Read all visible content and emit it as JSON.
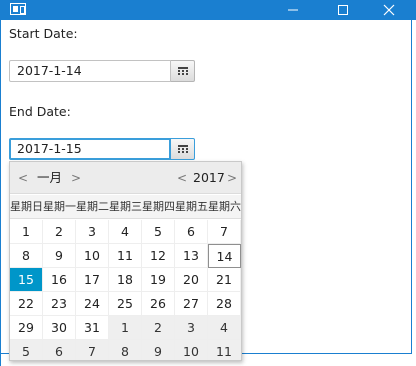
{
  "window": {
    "icons": [
      "app-icon",
      "minimize-icon",
      "maximize-icon",
      "close-icon"
    ],
    "accent_color": "#1a7fd0"
  },
  "form": {
    "start_label": "Start Date:",
    "start_value": "2017-1-14",
    "end_label": "End Date:",
    "end_value": "2017-1-15"
  },
  "calendar": {
    "month": "一月",
    "year": "2017",
    "prev": "<",
    "next": ">",
    "weekdays": [
      "星期日",
      "星期一",
      "星期二",
      "星期三",
      "星期四",
      "星期五",
      "星期六"
    ],
    "weeks": [
      [
        "1",
        "2",
        "3",
        "4",
        "5",
        "6",
        "7"
      ],
      [
        "8",
        "9",
        "10",
        "11",
        "12",
        "13",
        "14"
      ],
      [
        "15",
        "16",
        "17",
        "18",
        "19",
        "20",
        "21"
      ],
      [
        "22",
        "23",
        "24",
        "25",
        "26",
        "27",
        "28"
      ],
      [
        "29",
        "30",
        "31",
        "1",
        "2",
        "3",
        "4"
      ],
      [
        "5",
        "6",
        "7",
        "8",
        "9",
        "10",
        "11"
      ]
    ],
    "selected_day": "15",
    "today_day": "14",
    "selected_color": "#0096c9"
  }
}
